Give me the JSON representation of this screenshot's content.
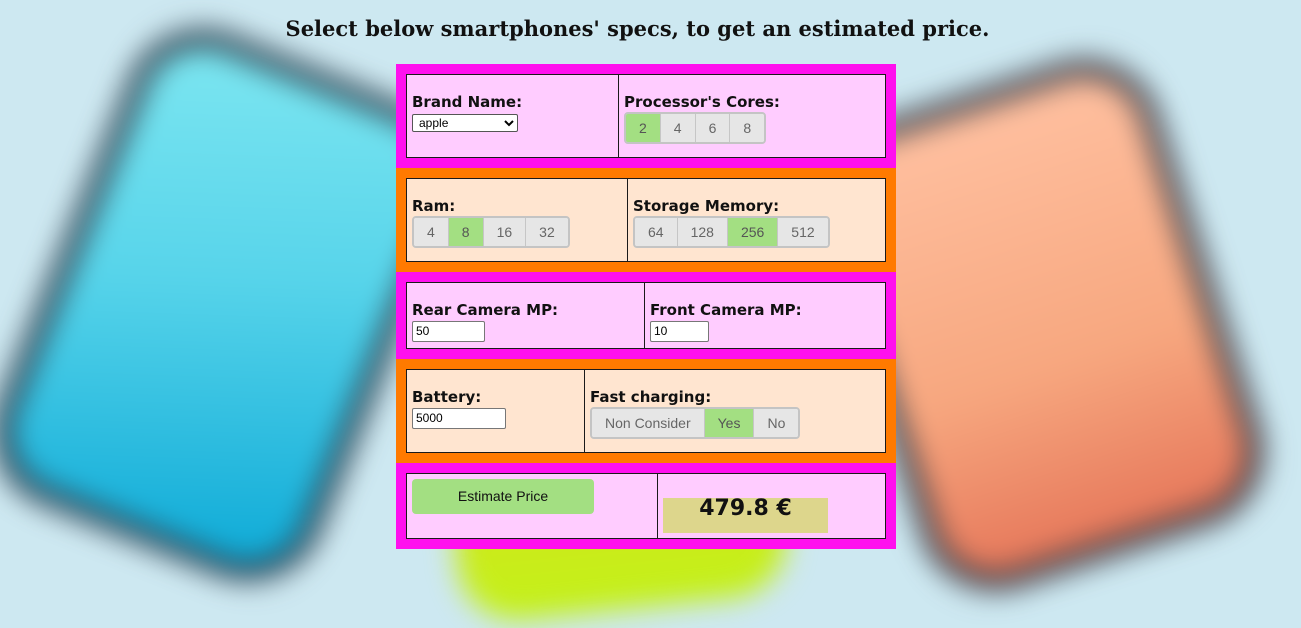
{
  "page": {
    "title": "Select below smartphones' specs, to get an estimated price."
  },
  "brand": {
    "label": "Brand Name:",
    "selected": "apple"
  },
  "cores": {
    "label": "Processor's Cores:",
    "options": [
      "2",
      "4",
      "6",
      "8"
    ],
    "selected": "2"
  },
  "ram": {
    "label": "Ram:",
    "options": [
      "4",
      "8",
      "16",
      "32"
    ],
    "selected": "8"
  },
  "storage": {
    "label": "Storage Memory:",
    "options": [
      "64",
      "128",
      "256",
      "512"
    ],
    "selected": "256"
  },
  "rear_camera": {
    "label": "Rear Camera MP:",
    "value": "50"
  },
  "front_camera": {
    "label": "Front Camera MP:",
    "value": "10"
  },
  "battery": {
    "label": "Battery:",
    "value": "5000"
  },
  "fast_charging": {
    "label": "Fast charging:",
    "options": [
      "Non Consider",
      "Yes",
      "No"
    ],
    "selected": "Yes"
  },
  "estimate": {
    "button_label": "Estimate Price",
    "result": "479.8 €"
  },
  "colors": {
    "band_magenta": "#ff10ee",
    "band_orange": "#ff7a00",
    "selected_green": "#a3df82",
    "price_bg": "#ddd68c"
  }
}
